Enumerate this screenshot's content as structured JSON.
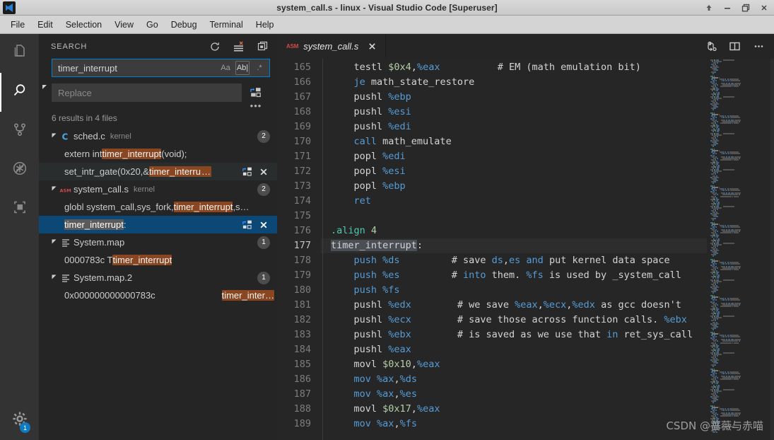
{
  "window": {
    "title": "system_call.s - linux - Visual Studio Code [Superuser]",
    "controls": {
      "restore_up_label": "Restore Up",
      "minimize_label": "Minimize",
      "maximize_label": "Maximize",
      "close_label": "Close"
    }
  },
  "menubar": {
    "items": [
      {
        "label": "File"
      },
      {
        "label": "Edit"
      },
      {
        "label": "Selection"
      },
      {
        "label": "View"
      },
      {
        "label": "Go"
      },
      {
        "label": "Debug"
      },
      {
        "label": "Terminal"
      },
      {
        "label": "Help"
      }
    ]
  },
  "activitybar": {
    "items": [
      {
        "name": "explorer",
        "icon": "files-icon",
        "active": false
      },
      {
        "name": "search",
        "icon": "search-icon",
        "active": true
      },
      {
        "name": "source-control",
        "icon": "source-control-icon",
        "active": false
      },
      {
        "name": "debug",
        "icon": "debug-no-icon",
        "active": false
      },
      {
        "name": "extensions",
        "icon": "extensions-icon",
        "active": false
      }
    ],
    "manage": {
      "icon": "gear-icon",
      "badge": "1"
    }
  },
  "sidebar": {
    "title": "SEARCH",
    "actions": [
      {
        "name": "refresh",
        "icon": "refresh-icon"
      },
      {
        "name": "clear-search-results",
        "icon": "clear-all-icon"
      },
      {
        "name": "open-new-search-editor",
        "icon": "new-editor-icon"
      }
    ],
    "search": {
      "value": "timer_interrupt",
      "placeholder": "Search",
      "options": [
        {
          "name": "match-case",
          "label": "Aa",
          "active": false
        },
        {
          "name": "match-whole-word",
          "label": "Ab|",
          "active": true
        },
        {
          "name": "use-regular-expression",
          "label": ".*",
          "active": false
        }
      ]
    },
    "replace": {
      "value": "",
      "placeholder": "Replace",
      "replace_all_icon": "replace-all-icon",
      "more_icon": "more-actions-icon"
    },
    "results_summary": "6 results in 4 files",
    "results": [
      {
        "type": "file",
        "name": "sched.c",
        "dir": "kernel",
        "icon": "c-file-icon",
        "count": "2",
        "expanded": true
      },
      {
        "type": "match",
        "selected": false,
        "hover": false,
        "parts": [
          {
            "t": "extern int ",
            "hl": false
          },
          {
            "t": "timer_interrupt",
            "hl": true
          },
          {
            "t": "(void);",
            "hl": false
          }
        ]
      },
      {
        "type": "match",
        "selected": false,
        "hover": true,
        "show_actions": true,
        "parts": [
          {
            "t": "set_intr_gate(0x20,&",
            "hl": false
          },
          {
            "t": "timer_interru",
            "hl": true
          },
          {
            "t": "…",
            "hl": true
          }
        ]
      },
      {
        "type": "file",
        "name": "system_call.s",
        "dir": "kernel",
        "icon": "asm-file-icon",
        "count": "2",
        "expanded": true
      },
      {
        "type": "match",
        "selected": false,
        "hover": false,
        "parts": [
          {
            "t": "globl system_call,sys_fork,",
            "hl": false
          },
          {
            "t": "timer_interrupt",
            "hl": true
          },
          {
            "t": ",s…",
            "hl": false
          }
        ]
      },
      {
        "type": "match",
        "selected": true,
        "hover": false,
        "show_actions": true,
        "parts": [
          {
            "t": "timer_interrupt",
            "hl": "sel"
          },
          {
            "t": ":",
            "hl": false
          }
        ]
      },
      {
        "type": "file",
        "name": "System.map",
        "dir": "",
        "icon": "text-file-icon",
        "count": "1",
        "expanded": true
      },
      {
        "type": "match",
        "selected": false,
        "hover": false,
        "parts": [
          {
            "t": "0000783c T ",
            "hl": false
          },
          {
            "t": "timer_interrupt",
            "hl": true
          }
        ]
      },
      {
        "type": "file",
        "name": "System.map.2",
        "dir": "",
        "icon": "text-file-icon",
        "count": "1",
        "expanded": true
      },
      {
        "type": "match",
        "selected": false,
        "hover": false,
        "right_align_match": true,
        "parts": [
          {
            "t": "0x000000000000783c",
            "hl": false
          },
          {
            "t": "                 ",
            "hl": false
          },
          {
            "t": "timer_inter…",
            "hl": true
          }
        ]
      }
    ]
  },
  "editor": {
    "tab": {
      "label": "system_call.s",
      "icon": "asm-file-icon",
      "close_icon": "close-icon",
      "dirty": false
    },
    "actions": [
      {
        "name": "compare-changes",
        "icon": "compare-icon"
      },
      {
        "name": "split-editor-right",
        "icon": "split-editor-icon"
      },
      {
        "name": "more-editor-actions",
        "icon": "more-actions-icon"
      }
    ],
    "first_line_number": 165,
    "current_line": 177,
    "lines": [
      {
        "n": 165,
        "tokens": [
          {
            "t": "    testl ",
            "c": "plain"
          },
          {
            "t": "$0x4",
            "c": "num"
          },
          {
            "t": ",",
            "c": "plain"
          },
          {
            "t": "%eax",
            "c": "reg"
          },
          {
            "t": "          # EM (math emulation bit)",
            "c": "plain"
          }
        ]
      },
      {
        "n": 166,
        "tokens": [
          {
            "t": "    ",
            "c": "plain"
          },
          {
            "t": "je",
            "c": "kw"
          },
          {
            "t": " math_state_restore",
            "c": "plain"
          }
        ]
      },
      {
        "n": 167,
        "tokens": [
          {
            "t": "    pushl ",
            "c": "plain"
          },
          {
            "t": "%ebp",
            "c": "reg"
          }
        ]
      },
      {
        "n": 168,
        "tokens": [
          {
            "t": "    pushl ",
            "c": "plain"
          },
          {
            "t": "%esi",
            "c": "reg"
          }
        ]
      },
      {
        "n": 169,
        "tokens": [
          {
            "t": "    pushl ",
            "c": "plain"
          },
          {
            "t": "%edi",
            "c": "reg"
          }
        ]
      },
      {
        "n": 170,
        "tokens": [
          {
            "t": "    ",
            "c": "plain"
          },
          {
            "t": "call",
            "c": "kw"
          },
          {
            "t": " math_emulate",
            "c": "plain"
          }
        ]
      },
      {
        "n": 171,
        "tokens": [
          {
            "t": "    popl ",
            "c": "plain"
          },
          {
            "t": "%edi",
            "c": "reg"
          }
        ]
      },
      {
        "n": 172,
        "tokens": [
          {
            "t": "    popl ",
            "c": "plain"
          },
          {
            "t": "%esi",
            "c": "reg"
          }
        ]
      },
      {
        "n": 173,
        "tokens": [
          {
            "t": "    popl ",
            "c": "plain"
          },
          {
            "t": "%ebp",
            "c": "reg"
          }
        ]
      },
      {
        "n": 174,
        "tokens": [
          {
            "t": "    ",
            "c": "plain"
          },
          {
            "t": "ret",
            "c": "kw"
          }
        ]
      },
      {
        "n": 175,
        "tokens": [
          {
            "t": "",
            "c": "plain"
          }
        ]
      },
      {
        "n": 176,
        "tokens": [
          {
            "t": ".align",
            "c": "dir"
          },
          {
            "t": " ",
            "c": "plain"
          },
          {
            "t": "4",
            "c": "num"
          }
        ]
      },
      {
        "n": 177,
        "tokens": [
          {
            "t": "timer_interrupt",
            "c": "seltok"
          },
          {
            "t": ":",
            "c": "plain"
          }
        ]
      },
      {
        "n": 178,
        "tokens": [
          {
            "t": "    ",
            "c": "plain"
          },
          {
            "t": "push",
            "c": "kw"
          },
          {
            "t": " ",
            "c": "plain"
          },
          {
            "t": "%ds",
            "c": "reg"
          },
          {
            "t": "         # save ",
            "c": "plain"
          },
          {
            "t": "ds",
            "c": "reg"
          },
          {
            "t": ",",
            "c": "plain"
          },
          {
            "t": "es",
            "c": "reg"
          },
          {
            "t": " ",
            "c": "plain"
          },
          {
            "t": "and",
            "c": "reg"
          },
          {
            "t": " put kernel data space",
            "c": "plain"
          }
        ]
      },
      {
        "n": 179,
        "tokens": [
          {
            "t": "    ",
            "c": "plain"
          },
          {
            "t": "push",
            "c": "kw"
          },
          {
            "t": " ",
            "c": "plain"
          },
          {
            "t": "%es",
            "c": "reg"
          },
          {
            "t": "         # ",
            "c": "plain"
          },
          {
            "t": "into",
            "c": "reg"
          },
          {
            "t": " them. ",
            "c": "plain"
          },
          {
            "t": "%fs",
            "c": "reg"
          },
          {
            "t": " is used by _system_call",
            "c": "plain"
          }
        ]
      },
      {
        "n": 180,
        "tokens": [
          {
            "t": "    ",
            "c": "plain"
          },
          {
            "t": "push",
            "c": "kw"
          },
          {
            "t": " ",
            "c": "plain"
          },
          {
            "t": "%fs",
            "c": "reg"
          }
        ]
      },
      {
        "n": 181,
        "tokens": [
          {
            "t": "    pushl ",
            "c": "plain"
          },
          {
            "t": "%edx",
            "c": "reg"
          },
          {
            "t": "        # we save ",
            "c": "plain"
          },
          {
            "t": "%eax",
            "c": "reg"
          },
          {
            "t": ",",
            "c": "plain"
          },
          {
            "t": "%ecx",
            "c": "reg"
          },
          {
            "t": ",",
            "c": "plain"
          },
          {
            "t": "%edx",
            "c": "reg"
          },
          {
            "t": " as gcc doesn't",
            "c": "plain"
          }
        ]
      },
      {
        "n": 182,
        "tokens": [
          {
            "t": "    pushl ",
            "c": "plain"
          },
          {
            "t": "%ecx",
            "c": "reg"
          },
          {
            "t": "        # save those across function calls. ",
            "c": "plain"
          },
          {
            "t": "%ebx",
            "c": "reg"
          }
        ]
      },
      {
        "n": 183,
        "tokens": [
          {
            "t": "    pushl ",
            "c": "plain"
          },
          {
            "t": "%ebx",
            "c": "reg"
          },
          {
            "t": "        # is saved as we use that ",
            "c": "plain"
          },
          {
            "t": "in",
            "c": "reg"
          },
          {
            "t": " ret_sys_call",
            "c": "plain"
          }
        ]
      },
      {
        "n": 184,
        "tokens": [
          {
            "t": "    pushl ",
            "c": "plain"
          },
          {
            "t": "%eax",
            "c": "reg"
          }
        ]
      },
      {
        "n": 185,
        "tokens": [
          {
            "t": "    movl ",
            "c": "plain"
          },
          {
            "t": "$0x10",
            "c": "num"
          },
          {
            "t": ",",
            "c": "plain"
          },
          {
            "t": "%eax",
            "c": "reg"
          }
        ]
      },
      {
        "n": 186,
        "tokens": [
          {
            "t": "    ",
            "c": "plain"
          },
          {
            "t": "mov",
            "c": "kw"
          },
          {
            "t": " ",
            "c": "plain"
          },
          {
            "t": "%ax",
            "c": "reg"
          },
          {
            "t": ",",
            "c": "plain"
          },
          {
            "t": "%ds",
            "c": "reg"
          }
        ]
      },
      {
        "n": 187,
        "tokens": [
          {
            "t": "    ",
            "c": "plain"
          },
          {
            "t": "mov",
            "c": "kw"
          },
          {
            "t": " ",
            "c": "plain"
          },
          {
            "t": "%ax",
            "c": "reg"
          },
          {
            "t": ",",
            "c": "plain"
          },
          {
            "t": "%es",
            "c": "reg"
          }
        ]
      },
      {
        "n": 188,
        "tokens": [
          {
            "t": "    movl ",
            "c": "plain"
          },
          {
            "t": "$0x17",
            "c": "num"
          },
          {
            "t": ",",
            "c": "plain"
          },
          {
            "t": "%eax",
            "c": "reg"
          }
        ]
      },
      {
        "n": 189,
        "tokens": [
          {
            "t": "    ",
            "c": "plain"
          },
          {
            "t": "mov",
            "c": "kw"
          },
          {
            "t": " ",
            "c": "plain"
          },
          {
            "t": "%ax",
            "c": "reg"
          },
          {
            "t": ",",
            "c": "plain"
          },
          {
            "t": "%fs",
            "c": "reg"
          }
        ]
      }
    ]
  },
  "watermark": "CSDN @蔷薇与赤喵",
  "colors": {
    "titlebar_bg": "#d0d0d0",
    "menubar_bg": "#d4d4d4",
    "activitybar_bg": "#333333",
    "sidebar_bg": "#252526",
    "editor_bg": "#262626",
    "selection_bg": "#0b4875",
    "match_highlight": "#8a4620",
    "badge_bg": "#0e7ac4",
    "keyword": "#569cd6",
    "number": "#b5cea8",
    "directive": "#4ec9b0"
  }
}
